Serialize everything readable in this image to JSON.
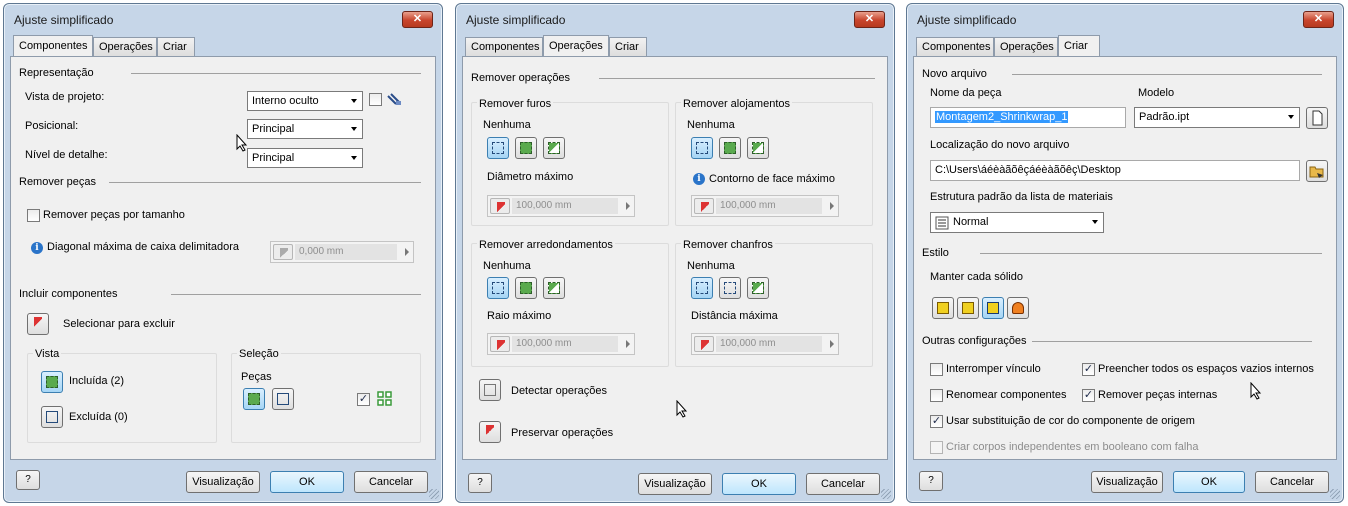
{
  "dialogs": [
    {
      "title": "Ajuste simplificado",
      "close": "✕",
      "tabs": [
        "Componentes",
        "Operações",
        "Criar"
      ],
      "representacao": "Representação",
      "vista_projeto": "Vista de projeto:",
      "vista_projeto_value": "Interno oculto",
      "posicional": "Posicional:",
      "posicional_value": "Principal",
      "nivel_detalhe": "Nível de detalhe:",
      "nivel_detalhe_value": "Principal",
      "remover_pecas": "Remover peças",
      "remover_por_tamanho": "Remover peças por tamanho",
      "diagonal": "Diagonal máxima de caixa delimitadora",
      "diagonal_value": "0,000 mm",
      "incluir": "Incluir componentes",
      "selecionar_excluir": "Selecionar para excluir",
      "vista": "Vista",
      "incluida": "Incluída (2)",
      "excluida": "Excluída (0)",
      "selecao": "Seleção",
      "pecas": "Peças",
      "help": "?",
      "visualizacao": "Visualização",
      "ok": "OK",
      "cancelar": "Cancelar"
    },
    {
      "title": "Ajuste simplificado",
      "close": "✕",
      "tabs": [
        "Componentes",
        "Operações",
        "Criar"
      ],
      "remover_operacoes": "Remover operações",
      "furos": "Remover furos",
      "furos_nenhuma": "Nenhuma",
      "furos_param": "Diâmetro máximo",
      "furos_value": "100,000 mm",
      "alojamentos": "Remover alojamentos",
      "aloj_nenhuma": "Nenhuma",
      "aloj_param": "Contorno de face máximo",
      "aloj_value": "100,000 mm",
      "arredondamentos": "Remover arredondamentos",
      "arred_nenhuma": "Nenhuma",
      "arred_param": "Raio máximo",
      "arred_value": "100,000 mm",
      "chanfros": "Remover chanfros",
      "chanf_nenhuma": "Nenhuma",
      "chanf_param": "Distância máxima",
      "chanf_value": "100,000 mm",
      "detectar": "Detectar operações",
      "preservar": "Preservar operações",
      "help": "?",
      "visualizacao": "Visualização",
      "ok": "OK",
      "cancelar": "Cancelar"
    },
    {
      "title": "Ajuste simplificado",
      "close": "✕",
      "tabs": [
        "Componentes",
        "Operações",
        "Criar"
      ],
      "novo_arquivo": "Novo arquivo",
      "nome_peca": "Nome da peça",
      "nome_peca_value": "Montagem2_Shrinkwrap_1",
      "modelo": "Modelo",
      "modelo_value": "Padrão.ipt",
      "localizacao": "Localização do novo arquivo",
      "localizacao_value": "C:\\Users\\áéèàãõêçáéèàãõêç\\Desktop",
      "estrutura": "Estrutura padrão da lista de materiais",
      "estrutura_value": "Normal",
      "estilo": "Estilo",
      "manter": "Manter cada sólido",
      "outras": "Outras configurações",
      "interromper": "Interromper vínculo",
      "preencher": "Preencher todos os espaços vazios internos",
      "renomear": "Renomear componentes",
      "remover_internas": "Remover peças internas",
      "usar_subst": "Usar substituição de cor do componente de origem",
      "criar_corpos": "Criar corpos independentes em booleano com falha",
      "check": "✓",
      "help": "?",
      "visualizacao": "Visualização",
      "ok": "OK",
      "cancelar": "Cancelar"
    }
  ],
  "colors": {
    "frame": "#c6d6e8",
    "panel": "#f0f0f0",
    "accent": "#3c7fb1",
    "close": "#c8452c"
  }
}
